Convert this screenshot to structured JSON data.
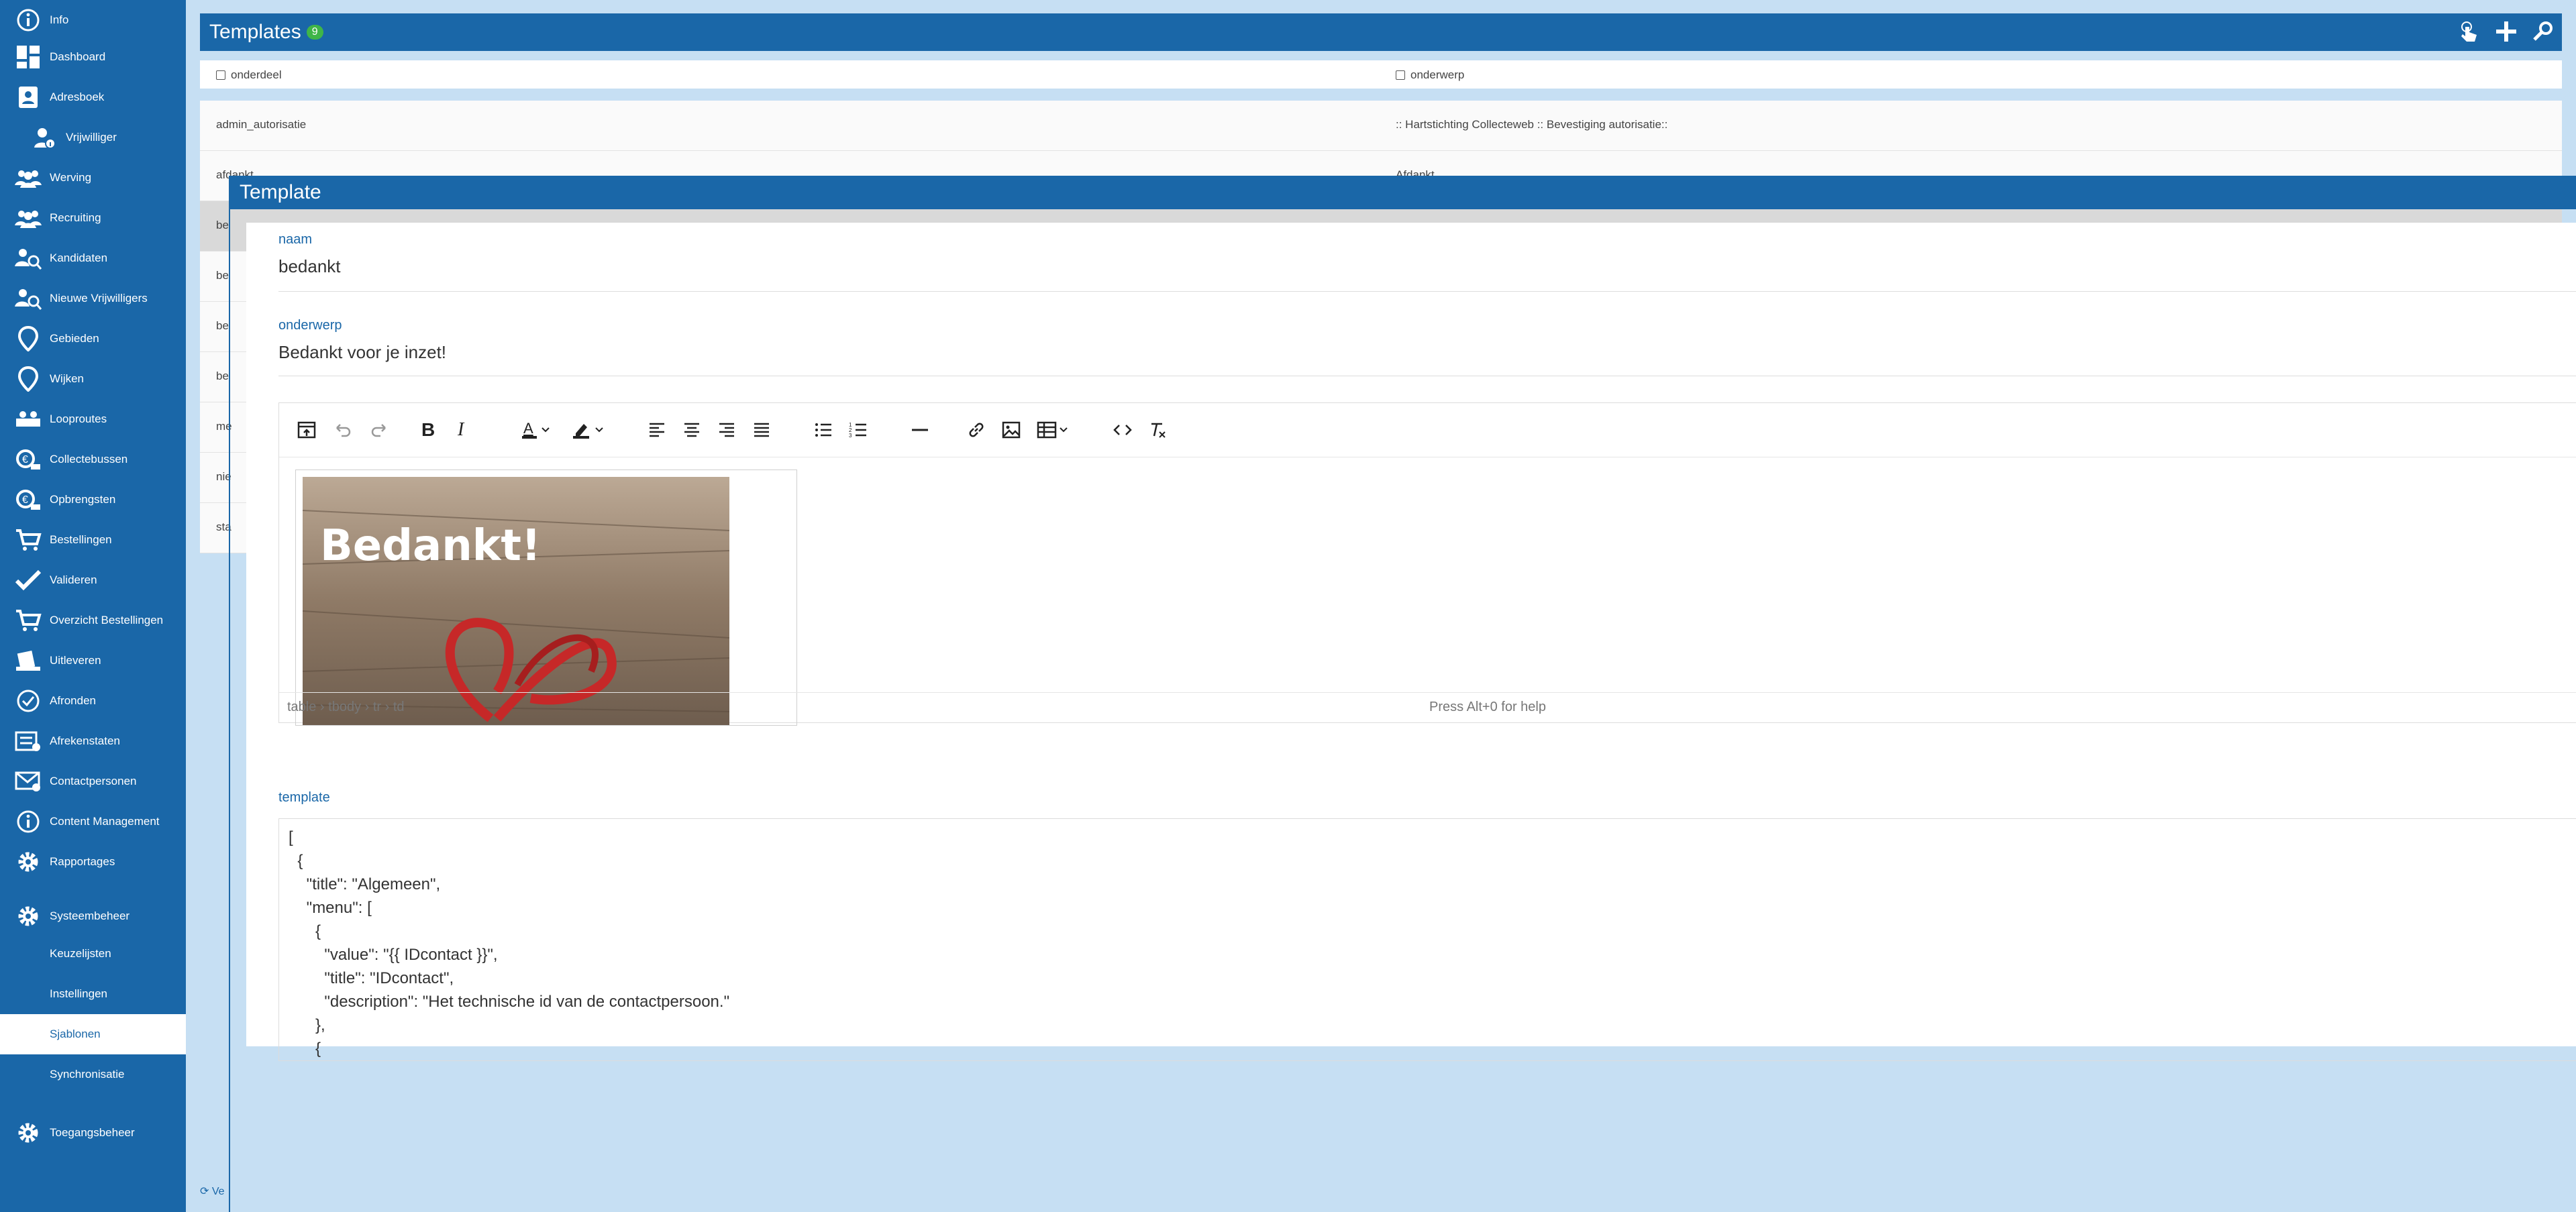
{
  "sidebar": {
    "items": [
      {
        "label": "Info",
        "icon": "info-icon"
      },
      {
        "label": "Dashboard",
        "icon": "dashboard-icon"
      },
      {
        "label": "Adresboek",
        "icon": "address-book-icon"
      },
      {
        "label": "Vrijwilliger",
        "icon": "user-info-icon"
      },
      {
        "label": "Werving",
        "icon": "group-icon"
      },
      {
        "label": "Recruiting",
        "icon": "group-icon"
      },
      {
        "label": "Kandidaten",
        "icon": "group-search-icon"
      },
      {
        "label": "Nieuwe Vrijwilligers",
        "icon": "group-search-icon"
      },
      {
        "label": "Gebieden",
        "icon": "map-pin-icon"
      },
      {
        "label": "Wijken",
        "icon": "map-pin-icon"
      },
      {
        "label": "Looproutes",
        "icon": "route-icon"
      },
      {
        "label": "Collectebussen",
        "icon": "collection-box-icon"
      },
      {
        "label": "Opbrengsten",
        "icon": "revenue-icon"
      },
      {
        "label": "Bestellingen",
        "icon": "cart-icon"
      },
      {
        "label": "Valideren",
        "icon": "check-icon"
      },
      {
        "label": "Overzicht Bestellingen",
        "icon": "cart-icon"
      },
      {
        "label": "Uitleveren",
        "icon": "deliver-icon"
      },
      {
        "label": "Afronden",
        "icon": "finish-icon"
      },
      {
        "label": "Afrekenstaten",
        "icon": "statement-icon"
      },
      {
        "label": "Contactpersonen",
        "icon": "contact-icon"
      },
      {
        "label": "Content Management",
        "icon": "info-icon"
      },
      {
        "label": "Rapportages",
        "icon": "gear-icon"
      },
      {
        "label": "Systeembeheer",
        "icon": "gear-icon"
      },
      {
        "label": "Keuzelijsten"
      },
      {
        "label": "Instellingen"
      },
      {
        "label": "Sjablonen"
      },
      {
        "label": "Synchronisatie"
      },
      {
        "label": "Toegangsbeheer",
        "icon": "gear-icon"
      }
    ],
    "active": "Sjablonen"
  },
  "list": {
    "title": "Templates",
    "count": "9",
    "columns": [
      "onderdeel",
      "onderwerp"
    ],
    "rows": [
      {
        "onderdeel": "admin_autorisatie",
        "onderwerp": ":: Hartstichting Collecteweb :: Bevestiging autorisatie::"
      },
      {
        "onderdeel": "afdankt",
        "onderwerp": "Afdankt"
      },
      {
        "onderdeel": "be",
        "onderwerp": ""
      },
      {
        "onderdeel": "be",
        "onderwerp": ""
      },
      {
        "onderdeel": "be",
        "onderwerp": ""
      },
      {
        "onderdeel": "be",
        "onderwerp": ""
      },
      {
        "onderdeel": "me",
        "onderwerp": ""
      },
      {
        "onderdeel": "nie",
        "onderwerp": ""
      },
      {
        "onderdeel": "sta",
        "onderwerp": ""
      }
    ],
    "version_label": "Ve"
  },
  "modal": {
    "title": "Template",
    "naam_label": "naam",
    "naam_value": "bedankt",
    "onderwerp_label": "onderwerp",
    "onderwerp_value": "Bedankt voor je inzet!",
    "image_text": "Bedankt!",
    "path": "table › tbody › tr › td",
    "help": "Press Alt+0 for help",
    "template_label": "template",
    "template_lines": [
      "[",
      "  {",
      "    \"title\": \"Algemeen\",",
      "    \"menu\": [",
      "      {",
      "        \"value\": \"{{ IDcontact }}\",",
      "        \"title\": \"IDcontact\",",
      "        \"description\": \"Het technische id van de contactpersoon.\"",
      "      },",
      "      {"
    ]
  },
  "colors": {
    "primary": "#1a67a8",
    "background": "#c6dff3",
    "badge": "#3fb548",
    "heart": "#c62828"
  }
}
